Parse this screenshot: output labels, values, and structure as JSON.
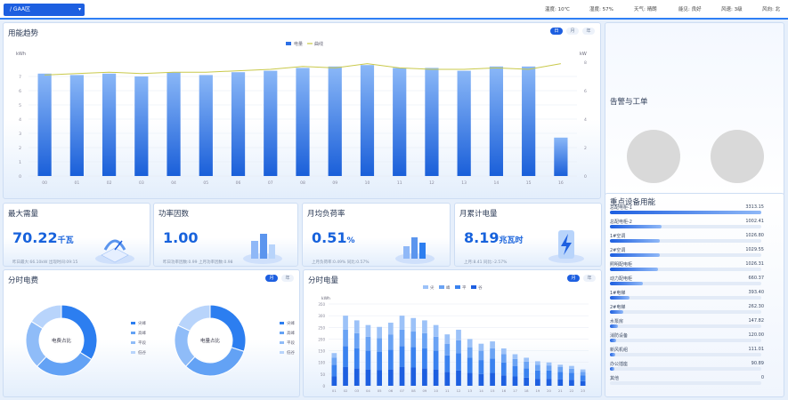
{
  "topbar": {
    "selector": "/ GAA区",
    "weather": [
      "温度: 10℃",
      "湿度: 57%",
      "天气: 晴朗",
      "能见: 良好",
      "风速: 3级",
      "风向: 北"
    ]
  },
  "trend": {
    "title": "用能趋势",
    "buttons": [
      "日",
      "月",
      "年"
    ],
    "chart_data": {
      "type": "bar",
      "legend": [
        "电量",
        "曲线"
      ],
      "ylabel_left": "kWh",
      "ylabel_right": "kW",
      "y_ticks": [
        "0",
        "1",
        "2",
        "3",
        "4",
        "5",
        "6",
        "7"
      ],
      "y_ticks_right": [
        "0",
        "2",
        "4",
        "6",
        "8"
      ],
      "ylim": [
        0,
        8
      ],
      "categories": [
        "00",
        "01",
        "02",
        "03",
        "04",
        "05",
        "06",
        "07",
        "08",
        "09",
        "10",
        "11",
        "12",
        "13",
        "14",
        "15",
        "16"
      ],
      "series": [
        {
          "name": "电量",
          "values": [
            7.2,
            7.1,
            7.2,
            7.0,
            7.3,
            7.1,
            7.3,
            7.4,
            7.6,
            7.7,
            7.8,
            7.6,
            7.6,
            7.4,
            7.7,
            7.7,
            2.7
          ]
        },
        {
          "name": "曲线",
          "values": [
            7.1,
            7.2,
            7.3,
            7.2,
            7.3,
            7.3,
            7.4,
            7.5,
            7.7,
            7.6,
            7.9,
            7.6,
            7.5,
            7.5,
            7.6,
            7.5,
            7.9
          ]
        }
      ]
    }
  },
  "alarm": {
    "title": "告警与工单"
  },
  "kpis": [
    {
      "title": "最大需量",
      "value": "70.22",
      "unit": "千瓦",
      "sub": "昨日最大:66.10kW    出现时间:09:15"
    },
    {
      "title": "功率因数",
      "value": "1.00",
      "unit": "",
      "sub": "昨日功率因数:0.99    上月功率因数:0.98"
    },
    {
      "title": "月均负荷率",
      "value": "0.51",
      "unit": "%",
      "sub": "上月负荷率:0.49%    同比:0.57%"
    },
    {
      "title": "月累计电量",
      "value": "8.19",
      "unit": "兆瓦时",
      "sub": "上月:8.41    同比:-2.57%"
    }
  ],
  "ranking": {
    "title": "重点设备用能",
    "items": [
      {
        "name": "总配电柜-1",
        "value": "3313.15",
        "pct": 1.0
      },
      {
        "name": "总配电柜-2",
        "value": "1002.41",
        "pct": 0.34
      },
      {
        "name": "1#空调",
        "value": "1026.80",
        "pct": 0.33
      },
      {
        "name": "2#空调",
        "value": "1029.55",
        "pct": 0.33
      },
      {
        "name": "照明配电柜",
        "value": "1026.31",
        "pct": 0.32
      },
      {
        "name": "动力配电柜",
        "value": "660.37",
        "pct": 0.22
      },
      {
        "name": "1#电梯",
        "value": "393.40",
        "pct": 0.13
      },
      {
        "name": "2#电梯",
        "value": "262.30",
        "pct": 0.09
      },
      {
        "name": "水泵房",
        "value": "147.82",
        "pct": 0.05
      },
      {
        "name": "消防设备",
        "value": "120.00",
        "pct": 0.04
      },
      {
        "name": "新风机组",
        "value": "111.01",
        "pct": 0.035
      },
      {
        "name": "办公插座",
        "value": "90.89",
        "pct": 0.03
      },
      {
        "name": "其他",
        "value": "0",
        "pct": 0.0
      }
    ]
  },
  "tou_cost": {
    "title": "分时电费",
    "buttons": [
      "月",
      "年"
    ],
    "donuts": [
      {
        "center": "电费占比",
        "legend": [
          "尖峰",
          "高峰",
          "平段",
          "低谷"
        ],
        "values": [
          34,
          28,
          22,
          16
        ]
      },
      {
        "center": "电量占比",
        "legend": [
          "尖峰",
          "高峰",
          "平段",
          "低谷"
        ],
        "values": [
          30,
          32,
          20,
          18
        ]
      }
    ],
    "colors": [
      "#2c7ef0",
      "#63a2f5",
      "#8fbcf8",
      "#b8d4fb"
    ]
  },
  "tou_energy": {
    "title": "分时电量",
    "buttons": [
      "月",
      "年"
    ],
    "chart_data": {
      "type": "bar",
      "stacked": true,
      "legend": [
        "尖",
        "峰",
        "平",
        "谷"
      ],
      "ylabel": "kWh",
      "y_ticks": [
        "0",
        "50",
        "100",
        "150",
        "200",
        "250",
        "300",
        "350"
      ],
      "ylim": [
        0,
        350
      ],
      "categories": [
        "01",
        "02",
        "03",
        "04",
        "05",
        "06",
        "07",
        "08",
        "09",
        "10",
        "11",
        "12",
        "13",
        "14",
        "15",
        "16",
        "17",
        "18",
        "19",
        "20",
        "21",
        "22",
        "23"
      ],
      "series": [
        {
          "name": "尖",
          "values": [
            40,
            80,
            75,
            70,
            68,
            70,
            80,
            78,
            75,
            70,
            60,
            65,
            55,
            50,
            55,
            45,
            40,
            35,
            30,
            30,
            28,
            25,
            20
          ]
        },
        {
          "name": "峰",
          "values": [
            50,
            90,
            85,
            80,
            78,
            85,
            90,
            88,
            85,
            80,
            70,
            75,
            65,
            60,
            62,
            55,
            45,
            40,
            35,
            35,
            32,
            30,
            25
          ]
        },
        {
          "name": "平",
          "values": [
            30,
            70,
            65,
            60,
            58,
            65,
            70,
            66,
            65,
            60,
            50,
            55,
            45,
            40,
            43,
            35,
            30,
            28,
            25,
            22,
            20,
            18,
            15
          ]
        },
        {
          "name": "谷",
          "values": [
            20,
            60,
            55,
            50,
            48,
            50,
            60,
            58,
            55,
            50,
            40,
            45,
            35,
            30,
            30,
            25,
            20,
            17,
            15,
            13,
            10,
            12,
            10
          ]
        }
      ]
    }
  }
}
